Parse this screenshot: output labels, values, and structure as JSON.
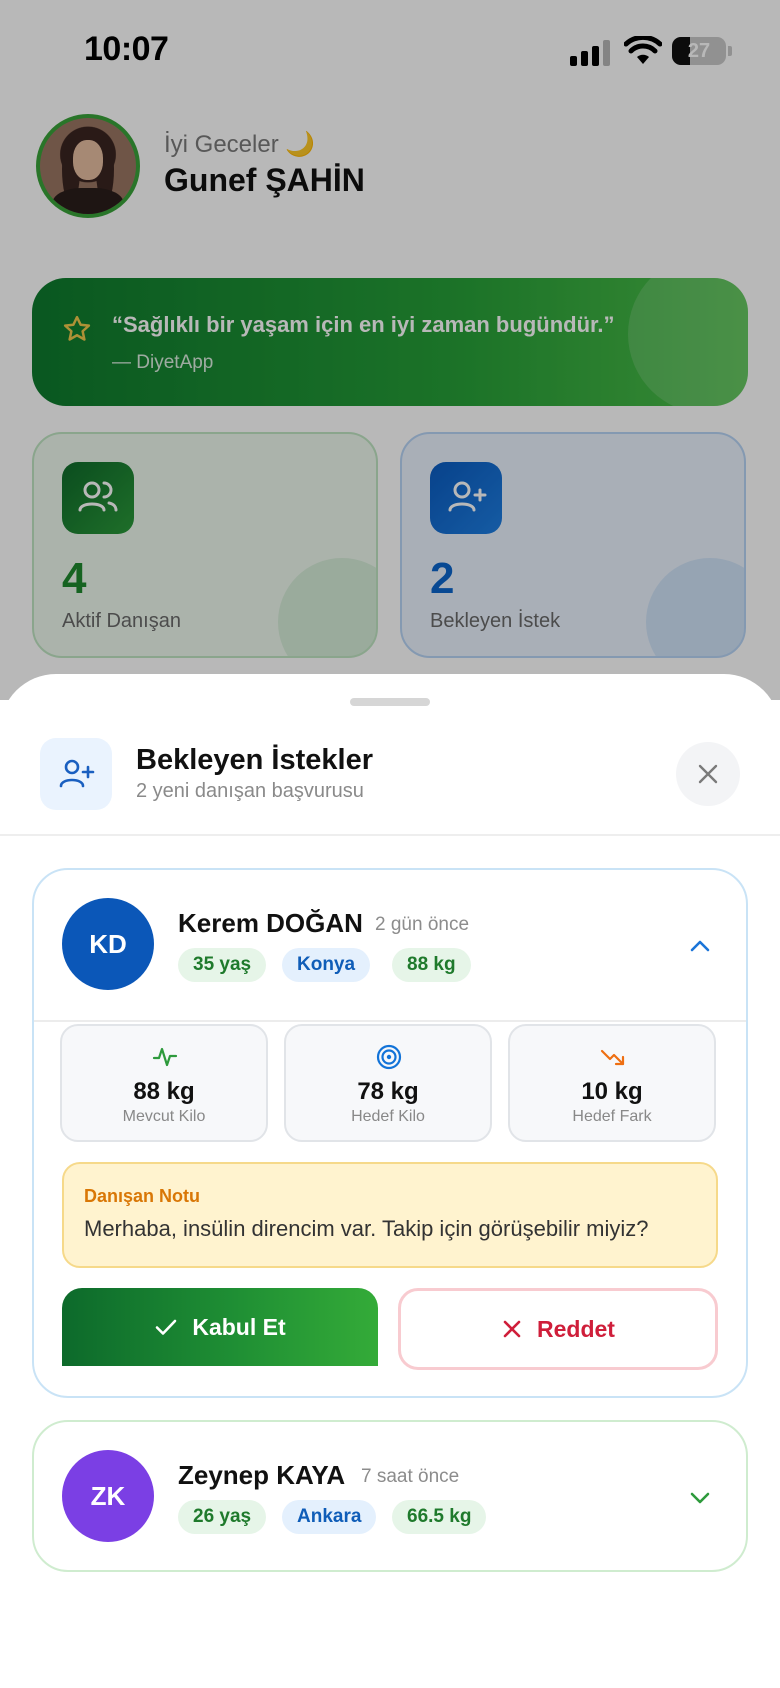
{
  "status_bar": {
    "time": "10:07",
    "battery": "27"
  },
  "header": {
    "greeting": "İyi Geceler 🌙",
    "user_name": "Gunef ŞAHİN"
  },
  "quote": {
    "text": "“Sağlıklı bir yaşam için en iyi zaman bugündür.”",
    "author": "— DiyetApp"
  },
  "stats": [
    {
      "value": "4",
      "label": "Aktif Danışan",
      "icon": "users-icon"
    },
    {
      "value": "2",
      "label": "Bekleyen İstek",
      "icon": "user-plus-icon"
    }
  ],
  "sheet": {
    "title": "Bekleyen İstekler",
    "subtitle": "2 yeni danışan başvurusu",
    "icon": "user-plus-icon",
    "close_icon": "close-icon"
  },
  "requests": [
    {
      "initials": "KD",
      "name": "Kerem DOĞAN",
      "time": "2 gün önce",
      "age": "35 yaş",
      "city": "Konya",
      "weight": "88 kg",
      "expanded": true,
      "avatar_color": "#0b57b8",
      "metrics": [
        {
          "value": "88 kg",
          "label": "Mevcut Kilo",
          "icon": "activity-icon",
          "color": "#2e9a3c"
        },
        {
          "value": "78 kg",
          "label": "Hedef Kilo",
          "icon": "target-icon",
          "color": "#1273d8"
        },
        {
          "value": "10 kg",
          "label": "Hedef Fark",
          "icon": "trending-down-icon",
          "color": "#ee6f12"
        }
      ],
      "note_title": "Danışan Notu",
      "note_text": "Merhaba, insülin direncim var. Takip için görüşebilir miyiz?",
      "accept_label": "Kabul Et",
      "reject_label": "Reddet"
    },
    {
      "initials": "ZK",
      "name": "Zeynep KAYA",
      "time": "7 saat önce",
      "age": "26 yaş",
      "city": "Ankara",
      "weight": "66.5 kg",
      "expanded": false,
      "avatar_color": "#7b3fe4"
    }
  ],
  "colors": {
    "primary_green": "#1f8f34",
    "primary_blue": "#0c66cc",
    "danger": "#cf1e3a",
    "warning": "#d97706"
  }
}
